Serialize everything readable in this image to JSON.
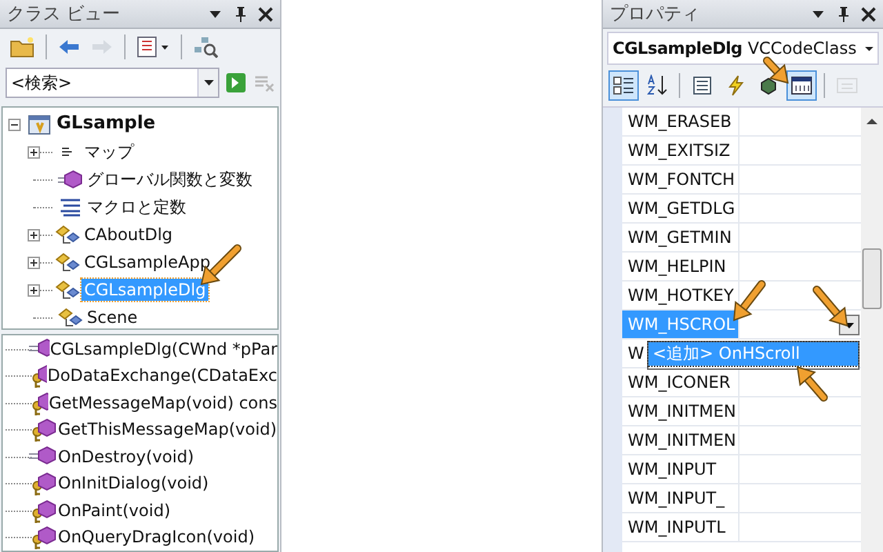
{
  "class_view": {
    "title": "クラス ビュー",
    "toolbar": [
      {
        "kind": "folder",
        "disabled": false
      },
      {
        "kind": "back",
        "disabled": false
      },
      {
        "kind": "forward",
        "disabled": true
      },
      {
        "kind": "list",
        "disabled": false
      },
      {
        "kind": "diagram",
        "disabled": false
      }
    ],
    "search": {
      "value": "<検索>"
    },
    "tree": [
      {
        "label": "GLsample",
        "kind": "project",
        "expanded": true,
        "selected": false,
        "children": [
          {
            "label": "マップ",
            "kind": "map",
            "expanded": false,
            "selected": false
          },
          {
            "label": "グローバル関数と変数",
            "kind": "global",
            "selected": false
          },
          {
            "label": "マクロと定数",
            "kind": "macro",
            "selected": false
          },
          {
            "label": "CAboutDlg",
            "kind": "class",
            "expanded": false,
            "selected": false
          },
          {
            "label": "CGLsampleApp",
            "kind": "class",
            "expanded": false,
            "selected": false
          },
          {
            "label": "CGLsampleDlg",
            "kind": "class",
            "expanded": false,
            "selected": true
          },
          {
            "label": "Scene",
            "kind": "class",
            "selected": false
          }
        ]
      }
    ],
    "members": [
      {
        "label": "CGLsampleDlg(CWnd *pPar",
        "kind": "public"
      },
      {
        "label": "DoDataExchange(CDataExc",
        "kind": "protected"
      },
      {
        "label": "GetMessageMap(void) cons",
        "kind": "protected"
      },
      {
        "label": "GetThisMessageMap(void)",
        "kind": "protected"
      },
      {
        "label": "OnDestroy(void)",
        "kind": "public"
      },
      {
        "label": "OnInitDialog(void)",
        "kind": "protected"
      },
      {
        "label": "OnPaint(void)",
        "kind": "protected"
      },
      {
        "label": "OnQueryDragIcon(void)",
        "kind": "protected"
      }
    ]
  },
  "properties": {
    "title": "プロパティ",
    "object_name": "CGLsampleDlg",
    "object_type": "VCCodeClass",
    "toolbar": [
      {
        "kind": "categorized",
        "selected": true,
        "disabled": false
      },
      {
        "kind": "alphabetical",
        "selected": false,
        "disabled": false
      },
      {
        "kind": "properties",
        "selected": false,
        "disabled": false
      },
      {
        "kind": "events",
        "selected": false,
        "disabled": false
      },
      {
        "kind": "messages",
        "selected": false,
        "disabled": false
      },
      {
        "kind": "overrides",
        "selected": true,
        "disabled": false
      },
      {
        "kind": "pages",
        "selected": false,
        "disabled": true
      }
    ],
    "rows": [
      {
        "name": "WM_ERASEB",
        "selected": false
      },
      {
        "name": "WM_EXITSIZ",
        "selected": false
      },
      {
        "name": "WM_FONTCH",
        "selected": false
      },
      {
        "name": "WM_GETDLG",
        "selected": false
      },
      {
        "name": "WM_GETMIN",
        "selected": false
      },
      {
        "name": "WM_HELPIN",
        "selected": false
      },
      {
        "name": "WM_HOTKEY",
        "selected": false
      },
      {
        "name": "WM_HSCROL",
        "selected": true
      },
      {
        "name": "W",
        "selected": false
      },
      {
        "name": "WM_ICONER",
        "selected": false
      },
      {
        "name": "WM_INITMEN",
        "selected": false
      },
      {
        "name": "WM_INITMEN",
        "selected": false
      },
      {
        "name": "WM_INPUT",
        "selected": false
      },
      {
        "name": "WM_INPUT_",
        "selected": false
      },
      {
        "name": "WM_INPUTL",
        "selected": false
      }
    ],
    "dropdown": {
      "items": [
        {
          "label": "<追加> OnHScroll",
          "selected": true
        }
      ]
    }
  }
}
